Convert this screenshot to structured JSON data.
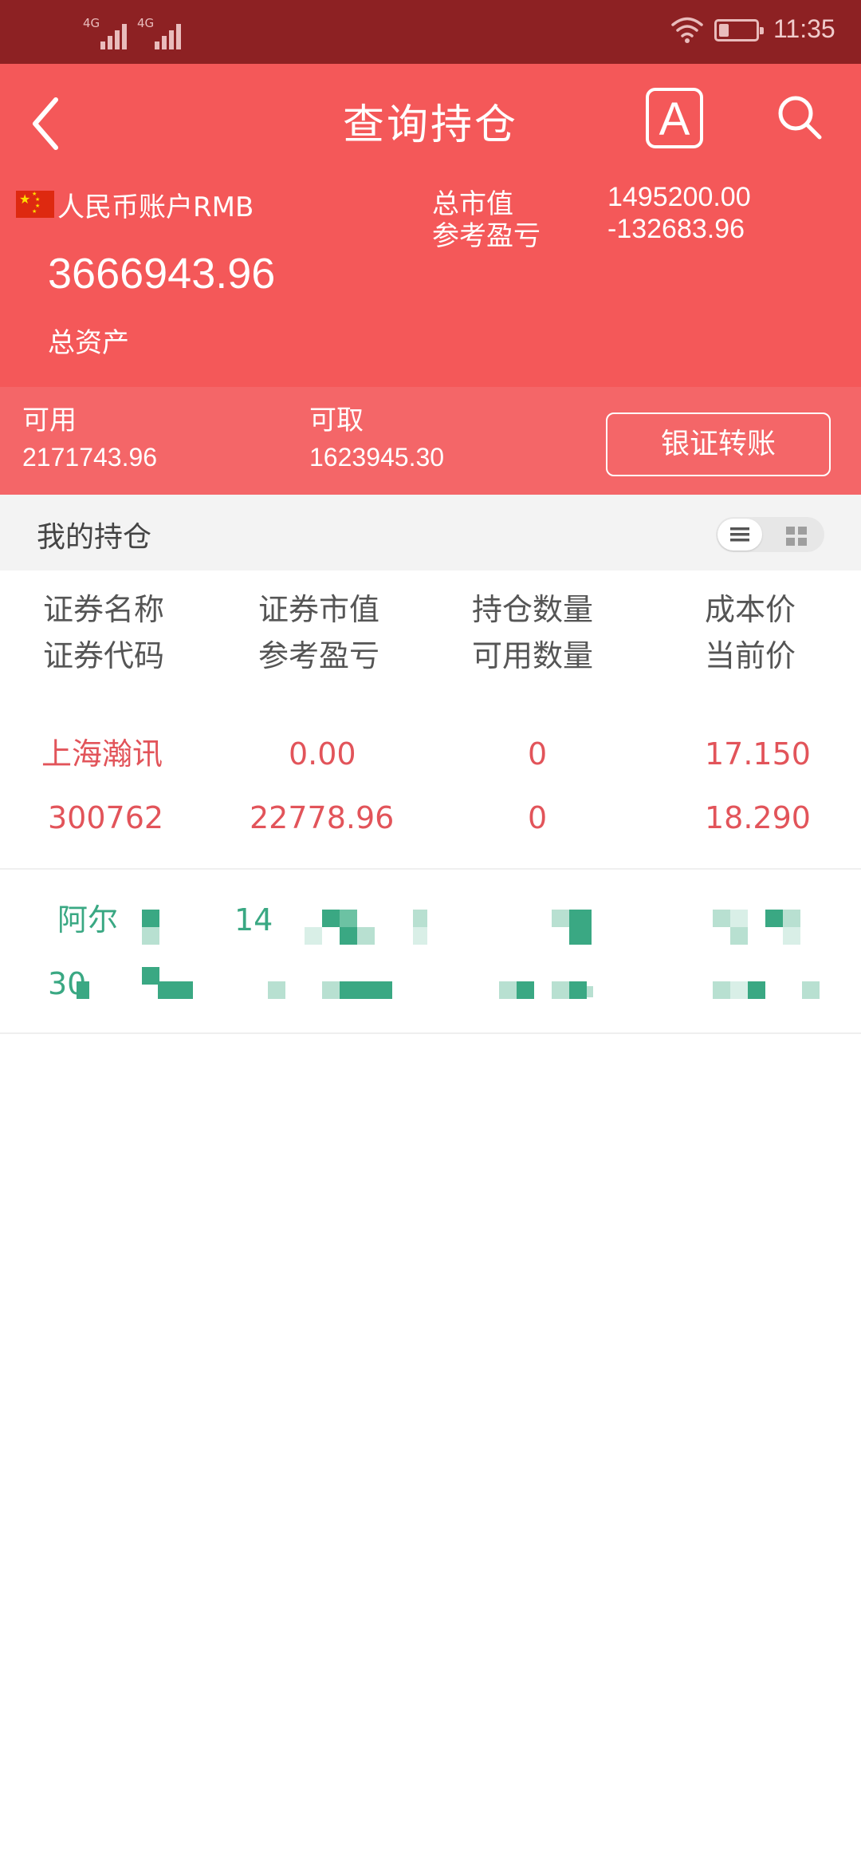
{
  "status_bar": {
    "net1": "4G",
    "net2": "4G",
    "time": "11:35",
    "battery_level": 0.28
  },
  "header": {
    "title": "查询持仓",
    "font_button": "A",
    "account": {
      "name": "人民币账户RMB",
      "flag": "cn-flag"
    },
    "total_assets": {
      "value": "3666943.96",
      "label": "总资产"
    },
    "market_value": {
      "label": "总市值",
      "value": "1495200.00"
    },
    "pnl": {
      "label": "参考盈亏",
      "value": "-132683.96"
    }
  },
  "available": {
    "usable": {
      "label": "可用",
      "value": "2171743.96"
    },
    "withdrawable": {
      "label": "可取",
      "value": "1623945.30"
    },
    "transfer_button": "银证转账"
  },
  "positions": {
    "section_title": "我的持仓",
    "view_mode": "list",
    "columns": [
      {
        "top": "证券名称",
        "bottom": "证券代码"
      },
      {
        "top": "证券市值",
        "bottom": "参考盈亏"
      },
      {
        "top": "持仓数量",
        "bottom": "可用数量"
      },
      {
        "top": "成本价",
        "bottom": "当前价"
      }
    ],
    "rows": [
      {
        "name": "上海瀚讯",
        "code": "300762",
        "market_value": "0.00",
        "pnl": "22778.96",
        "qty": "0",
        "avail_qty": "0",
        "cost": "17.150",
        "price": "18.290"
      },
      {
        "name_partial": "阿尔",
        "code_partial": "30",
        "value_partial": "14",
        "obscured": true
      }
    ]
  },
  "colors": {
    "status_bar": "#8d2123",
    "header": "#f45859",
    "strip": "#f46668",
    "loss_red": "#e2545a",
    "gain_green": "#3aa883"
  }
}
